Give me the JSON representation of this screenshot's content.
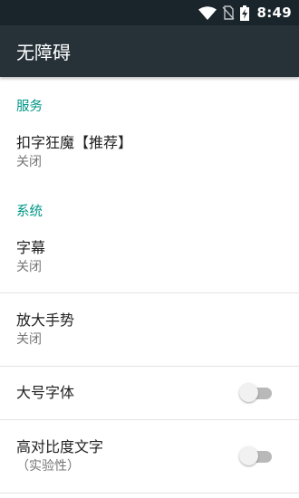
{
  "status_bar": {
    "time": "8:49",
    "icons": [
      "wifi-icon",
      "no-sim-icon",
      "battery-charging-icon"
    ]
  },
  "app_bar": {
    "title": "无障碍"
  },
  "sections": {
    "services": {
      "header": "服务",
      "items": [
        {
          "title": "扣字狂魔【推荐】",
          "summary": "关闭"
        }
      ]
    },
    "system": {
      "header": "系统",
      "items": [
        {
          "title": "字幕",
          "summary": "关闭"
        },
        {
          "title": "放大手势",
          "summary": "关闭"
        },
        {
          "title": "大号字体",
          "toggle": false
        },
        {
          "title": "高对比度文字",
          "summary": "（实验性）",
          "toggle": false
        }
      ]
    }
  },
  "colors": {
    "status_bar": "#1a252b",
    "app_bar": "#263238",
    "accent": "#009688",
    "toggle_off_track": "#b9b9b9",
    "toggle_off_thumb": "#f1f1f1"
  }
}
